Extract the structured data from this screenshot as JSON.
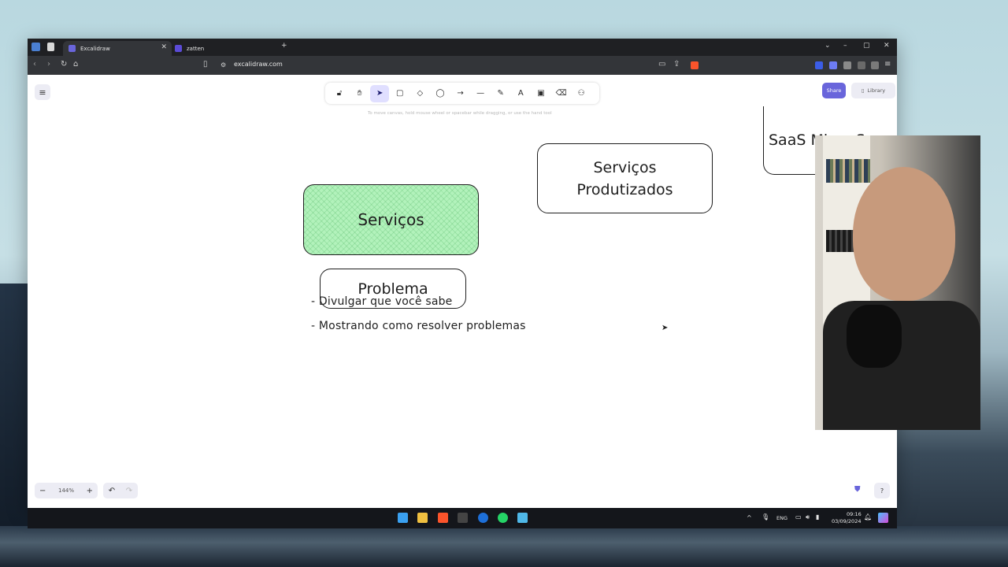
{
  "browser": {
    "tabs": [
      {
        "label": "Excalidraw",
        "active": true
      },
      {
        "label": "zatten",
        "active": false
      }
    ],
    "new_tab": "+",
    "url": "excalidraw.com",
    "window_controls": {
      "minimize": "–",
      "maximize": "▢",
      "close": "✕",
      "dropdown": "⌄"
    }
  },
  "app": {
    "toolbar": {
      "tools": [
        {
          "name": "lock-icon",
          "glyph": "🔓︎",
          "key": ""
        },
        {
          "name": "hand-icon",
          "glyph": "✋︎",
          "key": ""
        },
        {
          "name": "selection-icon",
          "glyph": "➤",
          "key": "1"
        },
        {
          "name": "rectangle-icon",
          "glyph": "▢",
          "key": "2"
        },
        {
          "name": "diamond-icon",
          "glyph": "◇",
          "key": "3"
        },
        {
          "name": "ellipse-icon",
          "glyph": "◯",
          "key": "4"
        },
        {
          "name": "arrow-icon",
          "glyph": "→",
          "key": "5"
        },
        {
          "name": "line-icon",
          "glyph": "—",
          "key": "6"
        },
        {
          "name": "pencil-icon",
          "glyph": "✎",
          "key": "7"
        },
        {
          "name": "text-icon",
          "glyph": "A",
          "key": "8"
        },
        {
          "name": "image-icon",
          "glyph": "▣",
          "key": "9"
        },
        {
          "name": "eraser-icon",
          "glyph": "⌫",
          "key": "0"
        },
        {
          "name": "shapes-icon",
          "glyph": "⚇",
          "key": ""
        }
      ],
      "active_tool": "selection-icon"
    },
    "hint": "To move canvas, hold mouse wheel or spacebar while dragging, or use the hand tool",
    "share_label": "Share",
    "library_label": "Library",
    "zoom": {
      "minus": "−",
      "value": "144%",
      "plus": "+"
    },
    "undo": "↶",
    "redo": "↷",
    "help": "?"
  },
  "canvas": {
    "shapes": {
      "servicos": "Serviços",
      "produtizados_line1": "Serviços",
      "produtizados_line2": "Produtizados",
      "problema": "Problema",
      "saas": "SaaS Micro Sa"
    },
    "bullets": [
      "- Divulgar que você sabe",
      "- Mostrando como resolver problemas"
    ]
  },
  "taskbar": {
    "lang": "ENG",
    "time": "09:16",
    "date": "03/09/2024"
  },
  "colors": {
    "accent": "#6965db",
    "green_fill": "#b2f2bb",
    "stroke": "#1e1e1e"
  }
}
